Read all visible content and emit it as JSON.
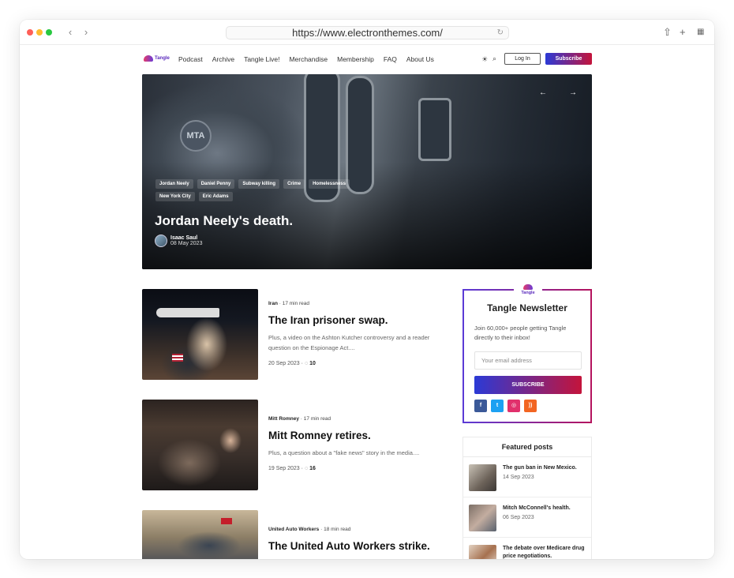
{
  "browser": {
    "url": "https://www.electronthemes.com/"
  },
  "site": {
    "logo_text": "Tangle",
    "nav": [
      "Podcast",
      "Archive",
      "Tangle Live!",
      "Merchandise",
      "Membership",
      "FAQ",
      "About Us"
    ],
    "login_label": "Log In",
    "subscribe_label": "Subscribe"
  },
  "hero": {
    "tags": [
      "Jordan Neely",
      "Daniel Penny",
      "Subway killing",
      "Crime",
      "Homelessness",
      "New York City",
      "Eric Adams"
    ],
    "title": "Jordan Neely's death.",
    "author": "Isaac Saul",
    "date": "08 May 2023",
    "prev_arrow": "←",
    "next_arrow": "→"
  },
  "articles": [
    {
      "tag": "Iran",
      "read": "17 min read",
      "title": "The Iran prisoner swap.",
      "excerpt": "Plus, a video on the Ashton Kutcher controversy and a reader question on the Espionage Act....",
      "date": "20 Sep 2023",
      "comments": "10"
    },
    {
      "tag": "Mitt Romney",
      "read": "17 min read",
      "title": "Mitt Romney retires.",
      "excerpt": "Plus, a question about a \"fake news\" story in the media....",
      "date": "19 Sep 2023",
      "comments": "16"
    },
    {
      "tag": "United Auto Workers",
      "read": "18 min read",
      "title": "The United Auto Workers strike.",
      "excerpt": "",
      "date": "",
      "comments": ""
    }
  ],
  "newsletter": {
    "logo_text": "Tangle",
    "title": "Tangle Newsletter",
    "description": "Join 60,000+ people getting Tangle directly to their inbox!",
    "email_placeholder": "Your email address",
    "button_label": "SUBSCRIBE",
    "socials": [
      {
        "icon": "facebook-icon",
        "glyph": "f",
        "color": "#3b5998"
      },
      {
        "icon": "twitter-icon",
        "glyph": "t",
        "color": "#1da1f2"
      },
      {
        "icon": "instagram-icon",
        "glyph": "◎",
        "color": "#e1306c"
      },
      {
        "icon": "rss-icon",
        "glyph": "))",
        "color": "#f26522"
      }
    ]
  },
  "featured": {
    "title": "Featured posts",
    "items": [
      {
        "title": "The gun ban in New Mexico.",
        "date": "14 Sep 2023"
      },
      {
        "title": "Mitch McConnell's health.",
        "date": "06 Sep 2023"
      },
      {
        "title": "The debate over Medicare drug price negotiations.",
        "date": ""
      }
    ]
  },
  "colors": {
    "accent_blue": "#2b3ad6",
    "accent_red": "#c4143b",
    "brand_purple": "#5b2bbd"
  }
}
